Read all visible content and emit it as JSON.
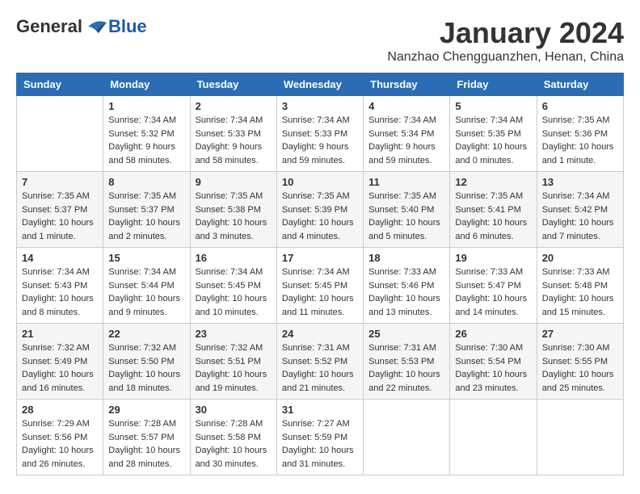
{
  "header": {
    "logo": {
      "general": "General",
      "blue": "Blue"
    },
    "title": "January 2024",
    "location": "Nanzhao Chengguanzhen, Henan, China"
  },
  "days_of_week": [
    "Sunday",
    "Monday",
    "Tuesday",
    "Wednesday",
    "Thursday",
    "Friday",
    "Saturday"
  ],
  "weeks": [
    [
      {
        "day": "",
        "sunrise": "",
        "sunset": "",
        "daylight": ""
      },
      {
        "day": "1",
        "sunrise": "Sunrise: 7:34 AM",
        "sunset": "Sunset: 5:32 PM",
        "daylight": "Daylight: 9 hours and 58 minutes."
      },
      {
        "day": "2",
        "sunrise": "Sunrise: 7:34 AM",
        "sunset": "Sunset: 5:33 PM",
        "daylight": "Daylight: 9 hours and 58 minutes."
      },
      {
        "day": "3",
        "sunrise": "Sunrise: 7:34 AM",
        "sunset": "Sunset: 5:33 PM",
        "daylight": "Daylight: 9 hours and 59 minutes."
      },
      {
        "day": "4",
        "sunrise": "Sunrise: 7:34 AM",
        "sunset": "Sunset: 5:34 PM",
        "daylight": "Daylight: 9 hours and 59 minutes."
      },
      {
        "day": "5",
        "sunrise": "Sunrise: 7:34 AM",
        "sunset": "Sunset: 5:35 PM",
        "daylight": "Daylight: 10 hours and 0 minutes."
      },
      {
        "day": "6",
        "sunrise": "Sunrise: 7:35 AM",
        "sunset": "Sunset: 5:36 PM",
        "daylight": "Daylight: 10 hours and 1 minute."
      }
    ],
    [
      {
        "day": "7",
        "sunrise": "Sunrise: 7:35 AM",
        "sunset": "Sunset: 5:37 PM",
        "daylight": "Daylight: 10 hours and 1 minute."
      },
      {
        "day": "8",
        "sunrise": "Sunrise: 7:35 AM",
        "sunset": "Sunset: 5:37 PM",
        "daylight": "Daylight: 10 hours and 2 minutes."
      },
      {
        "day": "9",
        "sunrise": "Sunrise: 7:35 AM",
        "sunset": "Sunset: 5:38 PM",
        "daylight": "Daylight: 10 hours and 3 minutes."
      },
      {
        "day": "10",
        "sunrise": "Sunrise: 7:35 AM",
        "sunset": "Sunset: 5:39 PM",
        "daylight": "Daylight: 10 hours and 4 minutes."
      },
      {
        "day": "11",
        "sunrise": "Sunrise: 7:35 AM",
        "sunset": "Sunset: 5:40 PM",
        "daylight": "Daylight: 10 hours and 5 minutes."
      },
      {
        "day": "12",
        "sunrise": "Sunrise: 7:35 AM",
        "sunset": "Sunset: 5:41 PM",
        "daylight": "Daylight: 10 hours and 6 minutes."
      },
      {
        "day": "13",
        "sunrise": "Sunrise: 7:34 AM",
        "sunset": "Sunset: 5:42 PM",
        "daylight": "Daylight: 10 hours and 7 minutes."
      }
    ],
    [
      {
        "day": "14",
        "sunrise": "Sunrise: 7:34 AM",
        "sunset": "Sunset: 5:43 PM",
        "daylight": "Daylight: 10 hours and 8 minutes."
      },
      {
        "day": "15",
        "sunrise": "Sunrise: 7:34 AM",
        "sunset": "Sunset: 5:44 PM",
        "daylight": "Daylight: 10 hours and 9 minutes."
      },
      {
        "day": "16",
        "sunrise": "Sunrise: 7:34 AM",
        "sunset": "Sunset: 5:45 PM",
        "daylight": "Daylight: 10 hours and 10 minutes."
      },
      {
        "day": "17",
        "sunrise": "Sunrise: 7:34 AM",
        "sunset": "Sunset: 5:45 PM",
        "daylight": "Daylight: 10 hours and 11 minutes."
      },
      {
        "day": "18",
        "sunrise": "Sunrise: 7:33 AM",
        "sunset": "Sunset: 5:46 PM",
        "daylight": "Daylight: 10 hours and 13 minutes."
      },
      {
        "day": "19",
        "sunrise": "Sunrise: 7:33 AM",
        "sunset": "Sunset: 5:47 PM",
        "daylight": "Daylight: 10 hours and 14 minutes."
      },
      {
        "day": "20",
        "sunrise": "Sunrise: 7:33 AM",
        "sunset": "Sunset: 5:48 PM",
        "daylight": "Daylight: 10 hours and 15 minutes."
      }
    ],
    [
      {
        "day": "21",
        "sunrise": "Sunrise: 7:32 AM",
        "sunset": "Sunset: 5:49 PM",
        "daylight": "Daylight: 10 hours and 16 minutes."
      },
      {
        "day": "22",
        "sunrise": "Sunrise: 7:32 AM",
        "sunset": "Sunset: 5:50 PM",
        "daylight": "Daylight: 10 hours and 18 minutes."
      },
      {
        "day": "23",
        "sunrise": "Sunrise: 7:32 AM",
        "sunset": "Sunset: 5:51 PM",
        "daylight": "Daylight: 10 hours and 19 minutes."
      },
      {
        "day": "24",
        "sunrise": "Sunrise: 7:31 AM",
        "sunset": "Sunset: 5:52 PM",
        "daylight": "Daylight: 10 hours and 21 minutes."
      },
      {
        "day": "25",
        "sunrise": "Sunrise: 7:31 AM",
        "sunset": "Sunset: 5:53 PM",
        "daylight": "Daylight: 10 hours and 22 minutes."
      },
      {
        "day": "26",
        "sunrise": "Sunrise: 7:30 AM",
        "sunset": "Sunset: 5:54 PM",
        "daylight": "Daylight: 10 hours and 23 minutes."
      },
      {
        "day": "27",
        "sunrise": "Sunrise: 7:30 AM",
        "sunset": "Sunset: 5:55 PM",
        "daylight": "Daylight: 10 hours and 25 minutes."
      }
    ],
    [
      {
        "day": "28",
        "sunrise": "Sunrise: 7:29 AM",
        "sunset": "Sunset: 5:56 PM",
        "daylight": "Daylight: 10 hours and 26 minutes."
      },
      {
        "day": "29",
        "sunrise": "Sunrise: 7:28 AM",
        "sunset": "Sunset: 5:57 PM",
        "daylight": "Daylight: 10 hours and 28 minutes."
      },
      {
        "day": "30",
        "sunrise": "Sunrise: 7:28 AM",
        "sunset": "Sunset: 5:58 PM",
        "daylight": "Daylight: 10 hours and 30 minutes."
      },
      {
        "day": "31",
        "sunrise": "Sunrise: 7:27 AM",
        "sunset": "Sunset: 5:59 PM",
        "daylight": "Daylight: 10 hours and 31 minutes."
      },
      {
        "day": "",
        "sunrise": "",
        "sunset": "",
        "daylight": ""
      },
      {
        "day": "",
        "sunrise": "",
        "sunset": "",
        "daylight": ""
      },
      {
        "day": "",
        "sunrise": "",
        "sunset": "",
        "daylight": ""
      }
    ]
  ]
}
